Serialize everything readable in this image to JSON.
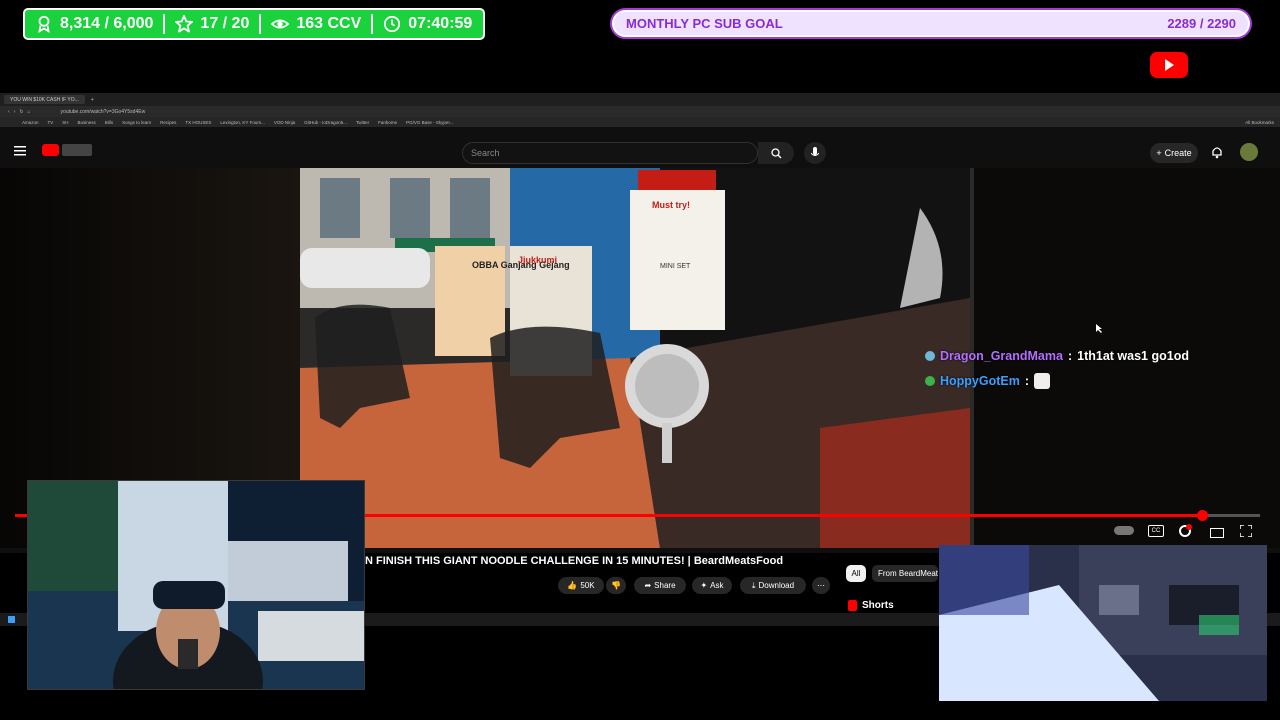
{
  "overlay": {
    "stats": [
      {
        "icon": "trophy-icon",
        "value": "8,314 / 6,000"
      },
      {
        "icon": "star-icon",
        "value": "17 / 20"
      },
      {
        "icon": "eye-icon",
        "value": "163 CCV"
      },
      {
        "icon": "clock-icon",
        "value": "07:40:59"
      }
    ],
    "sub_goal": {
      "label": "MONTHLY PC SUB GOAL",
      "progress": "2289 / 2290",
      "fraction": 0.9996
    },
    "brand_icon": "youtube-logo-icon"
  },
  "browser": {
    "tab_title": "YOU WIN $10K CASH IF YO...",
    "url": "youtube.com/watch?v=3Go4Y5sd4Ew",
    "bookmarks": [
      "Amazon",
      "TV",
      "SH",
      "Business",
      "Bills",
      "Songs to learn",
      "Recipes",
      "TX HOUSES",
      "Lexington, KY Fours...",
      "VOD Ninja",
      "GitHub - IoDragon5...",
      "Twitter",
      "Fanbome",
      "PG/VG Base - Skyper..."
    ],
    "all_bookmarks": "All Bookmarks"
  },
  "youtube": {
    "search_placeholder": "Search",
    "create_label": "Create",
    "video_title": "N FINISH THIS GIANT NOODLE CHALLENGE IN 15 MINUTES! | BeardMeatsFood",
    "likes": "50K",
    "share_label": "Share",
    "ask_label": "Ask",
    "download_label": "Download",
    "chips": {
      "all": "All",
      "from": "From BeardMeatsFood"
    },
    "shorts_label": "Shorts",
    "progress_fraction": 0.954,
    "video_signs": [
      "OBBA Ganjang Gejang",
      "Jjukkumi",
      "Must try!",
      "MINI SET"
    ]
  },
  "chat": [
    {
      "user": "Dragon_GrandMama",
      "separator": " : ",
      "message": "1th1at was1 go1od",
      "user_color": "#b46eff",
      "badge_color": "#6fb7d8"
    },
    {
      "user": "HoppyGotEm",
      "separator": " : ",
      "message": "",
      "user_color": "#3aa0ff",
      "badge_color": "#3bb34a"
    }
  ],
  "colors": {
    "stats_bg": "#19d23c",
    "goal_text": "#8a2bd0",
    "progress": "#ff0000"
  }
}
